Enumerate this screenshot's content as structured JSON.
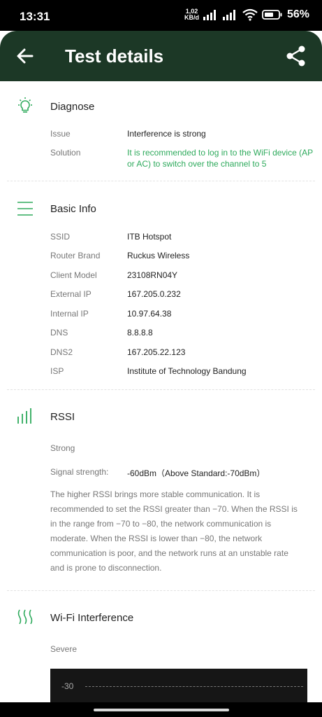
{
  "status_bar": {
    "time": "13:31",
    "net_speed_value": "1,02",
    "net_speed_unit": "KB/d",
    "battery": "56",
    "battery_suffix": "%"
  },
  "header": {
    "title": "Test details"
  },
  "diagnose": {
    "title": "Diagnose",
    "issue_label": "Issue",
    "issue_value": "Interference is strong",
    "solution_label": "Solution",
    "solution_value": "It is recommended to log in to the WiFi device (AP or AC) to switch over the channel to 5"
  },
  "basic_info": {
    "title": "Basic Info",
    "rows": [
      {
        "label": "SSID",
        "value": "ITB Hotspot"
      },
      {
        "label": "Router Brand",
        "value": "Ruckus Wireless"
      },
      {
        "label": "Client Model",
        "value": "23108RN04Y"
      },
      {
        "label": "External IP",
        "value": "167.205.0.232"
      },
      {
        "label": "Internal IP",
        "value": "10.97.64.38"
      },
      {
        "label": "DNS",
        "value": "8.8.8.8"
      },
      {
        "label": "DNS2",
        "value": "167.205.22.123"
      },
      {
        "label": "ISP",
        "value": "Institute of Technology Bandung"
      }
    ]
  },
  "rssi": {
    "title": "RSSI",
    "level": "Strong",
    "signal_label": "Signal strength:",
    "signal_value": "-60dBm（Above Standard:-70dBm）",
    "description": "The higher RSSI brings more stable communication. It is recommended to set the RSSI greater than −70. When the RSSI is in the range from −70 to −80, the network communication is moderate. When the RSSI is lower than −80, the network communication is poor, and the network runs at an unstable rate and is prone to disconnection."
  },
  "wifi_interference": {
    "title": "Wi-Fi Interference",
    "level": "Severe",
    "graph_label": "-30"
  },
  "colors": {
    "header_bg": "#1c3826",
    "accent_green": "#2eaa5c"
  }
}
